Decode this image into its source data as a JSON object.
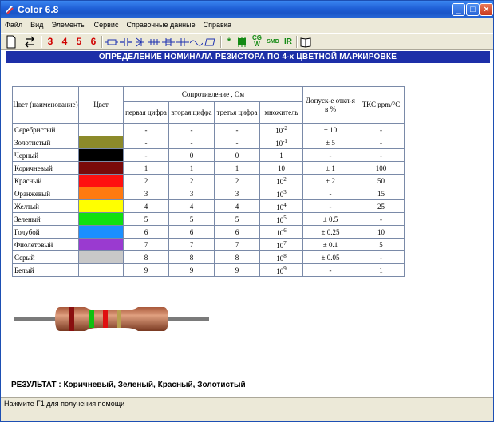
{
  "window": {
    "title": "Color 6.8",
    "min": "_",
    "max": "□",
    "close": "×"
  },
  "menu": [
    "Файл",
    "Вид",
    "Элементы",
    "Сервис",
    "Справочные данные",
    "Справка"
  ],
  "toolbar": {
    "digits": [
      "3",
      "4",
      "5",
      "6"
    ],
    "cgw": "CG W",
    "smd": "SMD",
    "ir": "IR"
  },
  "header": "ОПРЕДЕЛЕНИЕ НОМИНАЛА РЕЗИСТОРА ПО 4-х ЦВЕТНОЙ МАРКИРОВКЕ",
  "table": {
    "head_color_name": "Цвет (наименование)",
    "head_color": "Цвет",
    "head_resistance": "Сопротивление , Ом",
    "head_first": "первая цифра",
    "head_second": "вторая цифра",
    "head_third": "третья цифра",
    "head_mult": "множитель",
    "head_tol": "Допуск-е откл-я в %",
    "head_tcr": "ТКС ppm/°C",
    "rows": [
      {
        "name": "Серебристый",
        "color": "#ffffff",
        "d1": "-",
        "d2": "-",
        "d3": "-",
        "mult": "10",
        "exp": "-2",
        "tol": "± 10",
        "tcr": "-"
      },
      {
        "name": "Золотистый",
        "color": "#8c8a2a",
        "d1": "-",
        "d2": "-",
        "d3": "-",
        "mult": "10",
        "exp": "-1",
        "tol": "± 5",
        "tcr": "-"
      },
      {
        "name": "Черный",
        "color": "#000000",
        "d1": "-",
        "d2": "0",
        "d3": "0",
        "mult": "1",
        "exp": "",
        "tol": "-",
        "tcr": "-"
      },
      {
        "name": "Коричневый",
        "color": "#7a0a0a",
        "d1": "1",
        "d2": "1",
        "d3": "1",
        "mult": "10",
        "exp": "",
        "tol": "± 1",
        "tcr": "100"
      },
      {
        "name": "Красный",
        "color": "#ff1010",
        "d1": "2",
        "d2": "2",
        "d3": "2",
        "mult": "10",
        "exp": "2",
        "tol": "± 2",
        "tcr": "50"
      },
      {
        "name": "Оранжевый",
        "color": "#ff7a10",
        "d1": "3",
        "d2": "3",
        "d3": "3",
        "mult": "10",
        "exp": "3",
        "tol": "-",
        "tcr": "15"
      },
      {
        "name": "Желтый",
        "color": "#ffff00",
        "d1": "4",
        "d2": "4",
        "d3": "4",
        "mult": "10",
        "exp": "4",
        "tol": "-",
        "tcr": "25"
      },
      {
        "name": "Зеленый",
        "color": "#10e010",
        "d1": "5",
        "d2": "5",
        "d3": "5",
        "mult": "10",
        "exp": "5",
        "tol": "± 0.5",
        "tcr": "-"
      },
      {
        "name": "Голубой",
        "color": "#1a8fff",
        "d1": "6",
        "d2": "6",
        "d3": "6",
        "mult": "10",
        "exp": "6",
        "tol": "± 0.25",
        "tcr": "10"
      },
      {
        "name": "Фиолетовый",
        "color": "#9a3ad0",
        "d1": "7",
        "d2": "7",
        "d3": "7",
        "mult": "10",
        "exp": "7",
        "tol": "± 0.1",
        "tcr": "5"
      },
      {
        "name": "Серый",
        "color": "#c8c8c8",
        "d1": "8",
        "d2": "8",
        "d3": "8",
        "mult": "10",
        "exp": "8",
        "tol": "± 0.05",
        "tcr": "-"
      },
      {
        "name": "Белый",
        "color": "#ffffff",
        "d1": "9",
        "d2": "9",
        "d3": "9",
        "mult": "10",
        "exp": "9",
        "tol": "-",
        "tcr": "1"
      }
    ]
  },
  "resistor": {
    "bands": [
      "#8a1010",
      "#10c010",
      "#e01010",
      "#b8a050"
    ],
    "body_color": "#c8805a"
  },
  "result": "РЕЗУЛЬТАТ : Коричневый, Зеленый, Красный, Золотистый",
  "status": "Нажмите F1 для получения помощи"
}
